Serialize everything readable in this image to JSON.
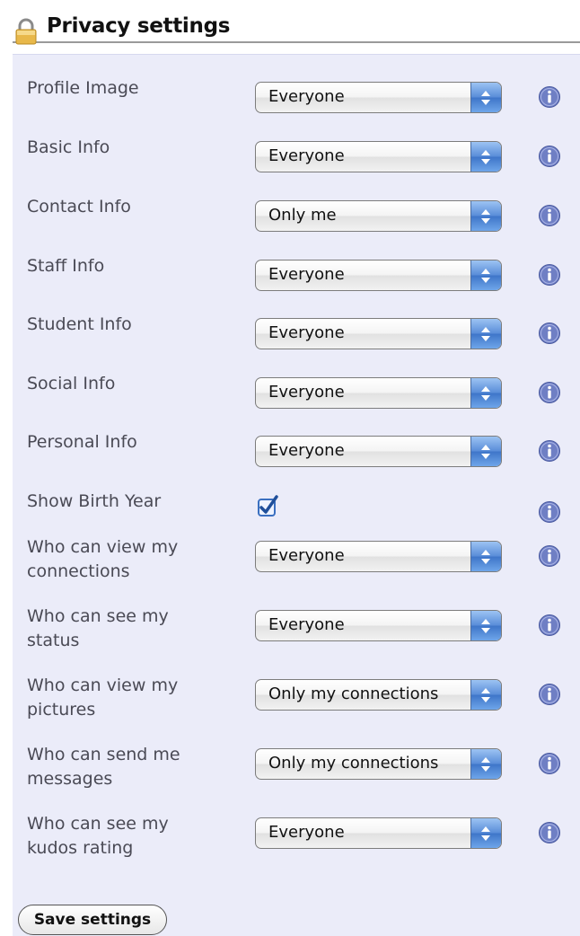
{
  "header": {
    "title": "Privacy settings",
    "icon": "lock-icon"
  },
  "settings": [
    {
      "label": "Profile Image",
      "type": "select",
      "value": "Everyone"
    },
    {
      "label": "Basic Info",
      "type": "select",
      "value": "Everyone"
    },
    {
      "label": "Contact Info",
      "type": "select",
      "value": "Only me"
    },
    {
      "label": "Staff Info",
      "type": "select",
      "value": "Everyone"
    },
    {
      "label": "Student Info",
      "type": "select",
      "value": "Everyone"
    },
    {
      "label": "Social Info",
      "type": "select",
      "value": "Everyone"
    },
    {
      "label": "Personal Info",
      "type": "select",
      "value": "Everyone"
    },
    {
      "label": "Show Birth Year",
      "type": "checkbox",
      "checked": true
    },
    {
      "label": "Who can view my connections",
      "type": "select",
      "value": "Everyone"
    },
    {
      "label": "Who can see my status",
      "type": "select",
      "value": "Everyone"
    },
    {
      "label": "Who can view my pictures",
      "type": "select",
      "value": "Only my connections"
    },
    {
      "label": "Who can send me messages",
      "type": "select",
      "value": "Only my connections"
    },
    {
      "label": "Who can see my kudos rating",
      "type": "select",
      "value": "Everyone"
    }
  ],
  "info_icon": "info-icon",
  "save_button": {
    "label": "Save settings"
  },
  "colors": {
    "panel_bg": "#ebecf9",
    "select_arrow": "#4f84d3",
    "info_icon": "#6f7fc4",
    "checkbox": "#3a6fc0"
  }
}
